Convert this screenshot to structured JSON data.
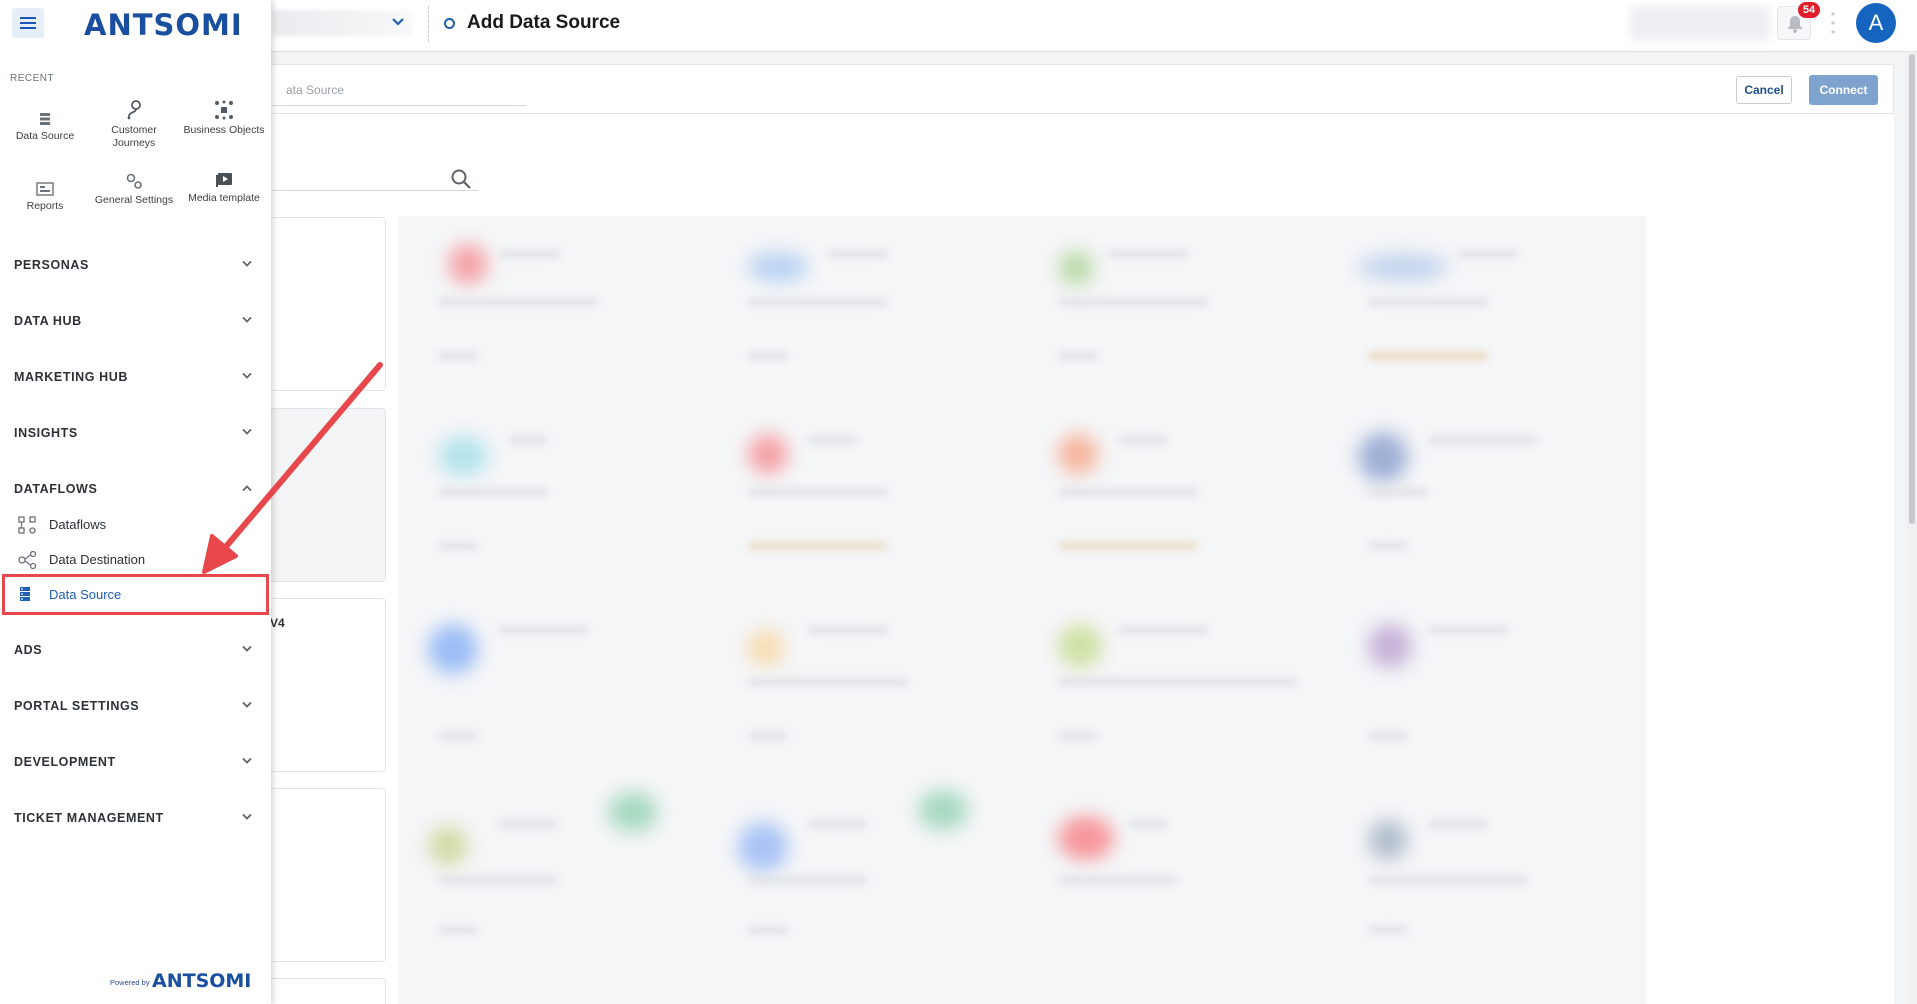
{
  "header": {
    "page_title": "Add Data Source",
    "notification_count": "54",
    "avatar_initial": "A"
  },
  "subheader": {
    "field_placeholder": "ata Source",
    "cancel_label": "Cancel",
    "connect_label": "Connect"
  },
  "content": {
    "card_partial_text": "V4"
  },
  "sidebar": {
    "logo": "ANTSOMI",
    "recent_label": "RECENT",
    "recent": [
      {
        "label": "Data Source",
        "icon": "data-source-icon"
      },
      {
        "label": "Customer Journeys",
        "icon": "journey-icon"
      },
      {
        "label": "Business Objects",
        "icon": "business-objects-icon"
      },
      {
        "label": "Reports",
        "icon": "reports-icon"
      },
      {
        "label": "General Settings",
        "icon": "gears-icon"
      },
      {
        "label": "Media template",
        "icon": "media-template-icon"
      }
    ],
    "sections": [
      {
        "label": "PERSONAS"
      },
      {
        "label": "DATA HUB"
      },
      {
        "label": "MARKETING HUB"
      },
      {
        "label": "INSIGHTS"
      },
      {
        "label": "DATAFLOWS"
      },
      {
        "label": "ADS"
      },
      {
        "label": "PORTAL SETTINGS"
      },
      {
        "label": "DEVELOPMENT"
      },
      {
        "label": "TICKET MANAGEMENT"
      }
    ],
    "dataflows_items": [
      {
        "label": "Dataflows",
        "icon": "dataflows-icon"
      },
      {
        "label": "Data Destination",
        "icon": "data-destination-icon"
      },
      {
        "label": "Data Source",
        "icon": "data-source-icon",
        "active": true
      }
    ],
    "powered_by": "Powered by",
    "powered_logo": "ANTSOMI"
  },
  "colors": {
    "brand": "#1a4fa0",
    "active_link": "#1f5fb8",
    "annotation_red": "#e8474b",
    "connect_button": "#7fa3cf",
    "badge_red": "#e11d2a"
  }
}
